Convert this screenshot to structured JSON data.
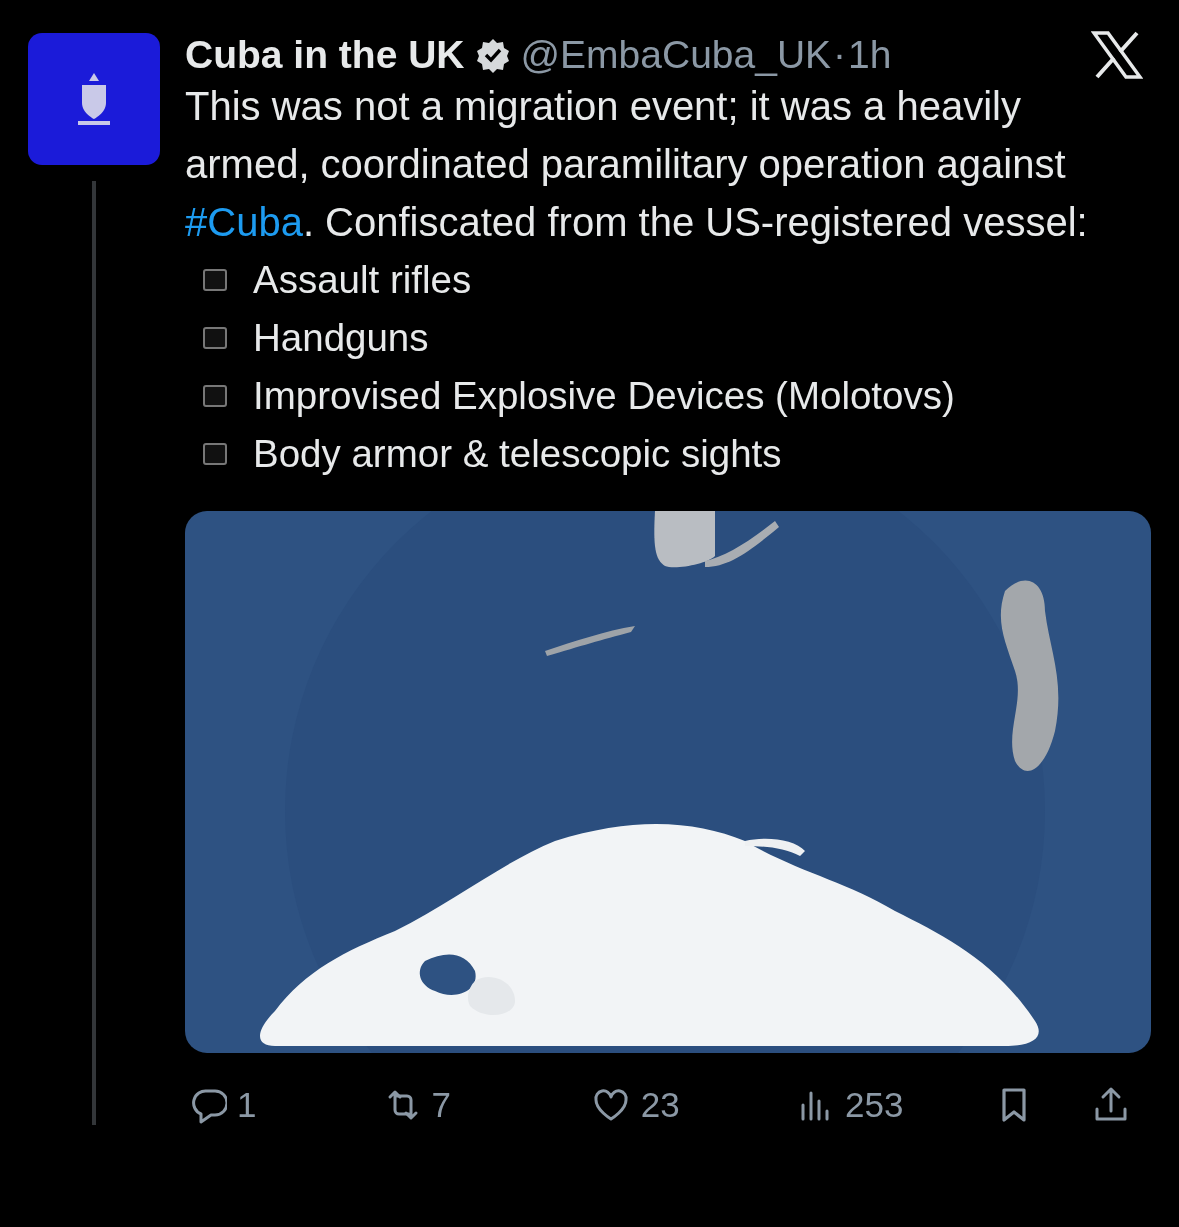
{
  "post": {
    "author": {
      "name": "Cuba in the UK",
      "verified": true,
      "handle": "@EmbaCuba_UK",
      "separator": "·",
      "time": "1h"
    },
    "text": [
      {
        "kind": "plain",
        "text": "This was not a migration event; it was a heavily armed, coordinated paramilitary operation against "
      },
      {
        "kind": "hashtag",
        "text": "#Cuba"
      },
      {
        "kind": "plain",
        "text": ". Confiscated from the US-registered vessel:"
      }
    ],
    "list": [
      {
        "text": "Assault rifles"
      },
      {
        "text": "Handguns"
      },
      {
        "text": "Improvised Explosive Devices (Molotovs)"
      },
      {
        "text": "Body armor & telescopic sights"
      }
    ],
    "actions": [
      {
        "kind": "reply",
        "count": "1"
      },
      {
        "kind": "repost",
        "count": "7"
      },
      {
        "kind": "like",
        "count": "23"
      },
      {
        "kind": "views",
        "count": "253"
      },
      {
        "kind": "bookmark"
      },
      {
        "kind": "share"
      }
    ]
  }
}
